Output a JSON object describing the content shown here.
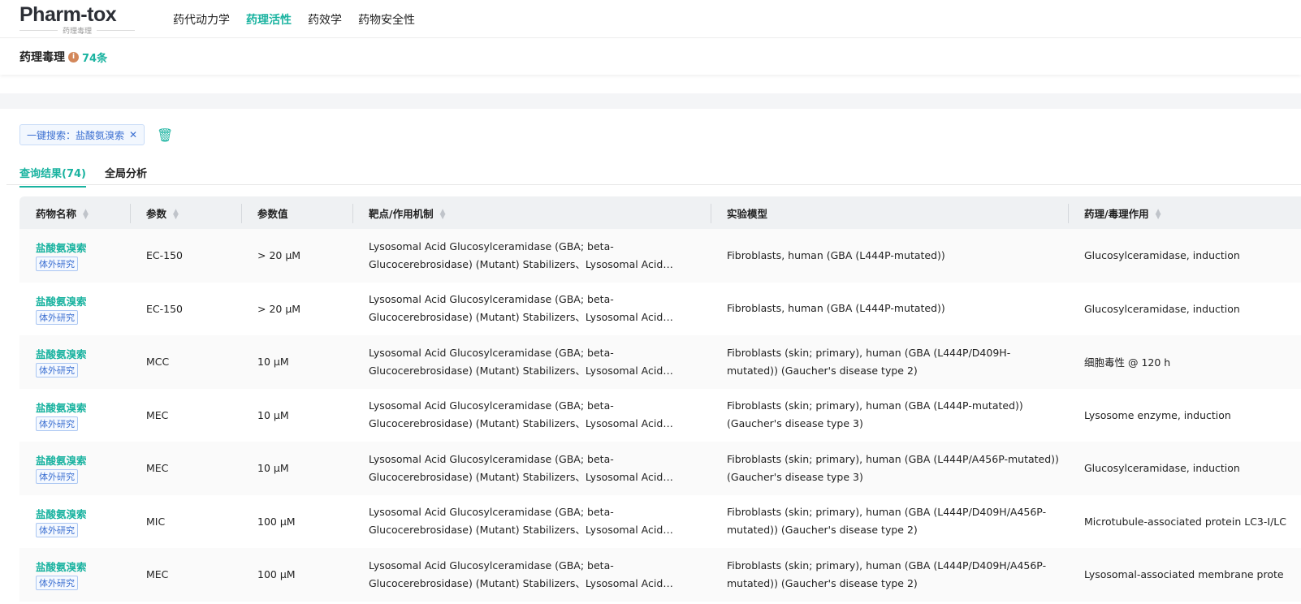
{
  "logo": {
    "text": "Pharm-tox",
    "subtitle": "药理毒理"
  },
  "nav": [
    "药代动力学",
    "药理活性",
    "药效学",
    "药物安全性"
  ],
  "nav_active": 1,
  "section": {
    "title": "药理毒理",
    "count": "74条"
  },
  "filter_chip": {
    "label": "一键搜索：盐酸氨溴索"
  },
  "tabs": [
    "查询结果(74)",
    "全局分析"
  ],
  "columns": [
    "药物名称",
    "参数",
    "参数值",
    "靶点/作用机制",
    "实验模型",
    "药理/毒理作用"
  ],
  "rows": [
    {
      "name": "盐酸氨溴索",
      "tag": "体外研究",
      "param": "EC-150",
      "value": "> 20 µM",
      "target": "Lysosomal Acid Glucosylceramidase (GBA; beta-Glucocerebrosidase) (Mutant) Stabilizers、Lysosomal Acid Glucosylceramidase (GBA; beta-Glucocerebrosidase)",
      "model": "Fibroblasts, human (GBA (L444P-mutated))",
      "effect": "Glucosylceramidase, induction"
    },
    {
      "name": "盐酸氨溴索",
      "tag": "体外研究",
      "param": "EC-150",
      "value": "> 20 µM",
      "target": "Lysosomal Acid Glucosylceramidase (GBA; beta-Glucocerebrosidase) (Mutant) Stabilizers、Lysosomal Acid Glucosylceramidase (GBA; beta-Glucocerebrosidase)",
      "model": "Fibroblasts, human (GBA (L444P-mutated))",
      "effect": "Glucosylceramidase, induction"
    },
    {
      "name": "盐酸氨溴索",
      "tag": "体外研究",
      "param": "MCC",
      "value": "10 µM",
      "target": "Lysosomal Acid Glucosylceramidase (GBA; beta-Glucocerebrosidase) (Mutant) Stabilizers、Lysosomal Acid Glucosylceramidase (GBA; beta-Glucocerebrosidase)",
      "model": "Fibroblasts (skin; primary), human (GBA (L444P/D409H-mutated)) (Gaucher's disease type 2)",
      "effect": "细胞毒性 @ 120 h"
    },
    {
      "name": "盐酸氨溴索",
      "tag": "体外研究",
      "param": "MEC",
      "value": "10 µM",
      "target": "Lysosomal Acid Glucosylceramidase (GBA; beta-Glucocerebrosidase) (Mutant) Stabilizers、Lysosomal Acid Glucosylceramidase (GBA; beta-Glucocerebrosidase)",
      "model": "Fibroblasts (skin; primary), human (GBA (L444P-mutated)) (Gaucher's disease type 3)",
      "effect": "Lysosome enzyme, induction"
    },
    {
      "name": "盐酸氨溴索",
      "tag": "体外研究",
      "param": "MEC",
      "value": "10 µM",
      "target": "Lysosomal Acid Glucosylceramidase (GBA; beta-Glucocerebrosidase) (Mutant) Stabilizers、Lysosomal Acid Glucosylceramidase (GBA; beta-Glucocerebrosidase)",
      "model": "Fibroblasts (skin; primary), human (GBA (L444P/A456P-mutated)) (Gaucher's disease type 3)",
      "effect": "Glucosylceramidase, induction"
    },
    {
      "name": "盐酸氨溴索",
      "tag": "体外研究",
      "param": "MIC",
      "value": "100 µM",
      "target": "Lysosomal Acid Glucosylceramidase (GBA; beta-Glucocerebrosidase) (Mutant) Stabilizers、Lysosomal Acid Glucosylceramidase (GBA; beta-Glucocerebrosidase)",
      "model": "Fibroblasts (skin; primary), human (GBA (L444P/D409H/A456P-mutated)) (Gaucher's disease type 2)",
      "effect": "Microtubule-associated protein LC3-I/LC"
    },
    {
      "name": "盐酸氨溴索",
      "tag": "体外研究",
      "param": "MEC",
      "value": "100 µM",
      "target": "Lysosomal Acid Glucosylceramidase (GBA; beta-Glucocerebrosidase) (Mutant) Stabilizers、Lysosomal Acid Glucosylceramidase (GBA; beta-Glucocerebrosidase)",
      "model": "Fibroblasts (skin; primary), human (GBA (L444P/D409H/A456P-mutated)) (Gaucher's disease type 2)",
      "effect": "Lysosomal-associated membrane prote"
    }
  ]
}
